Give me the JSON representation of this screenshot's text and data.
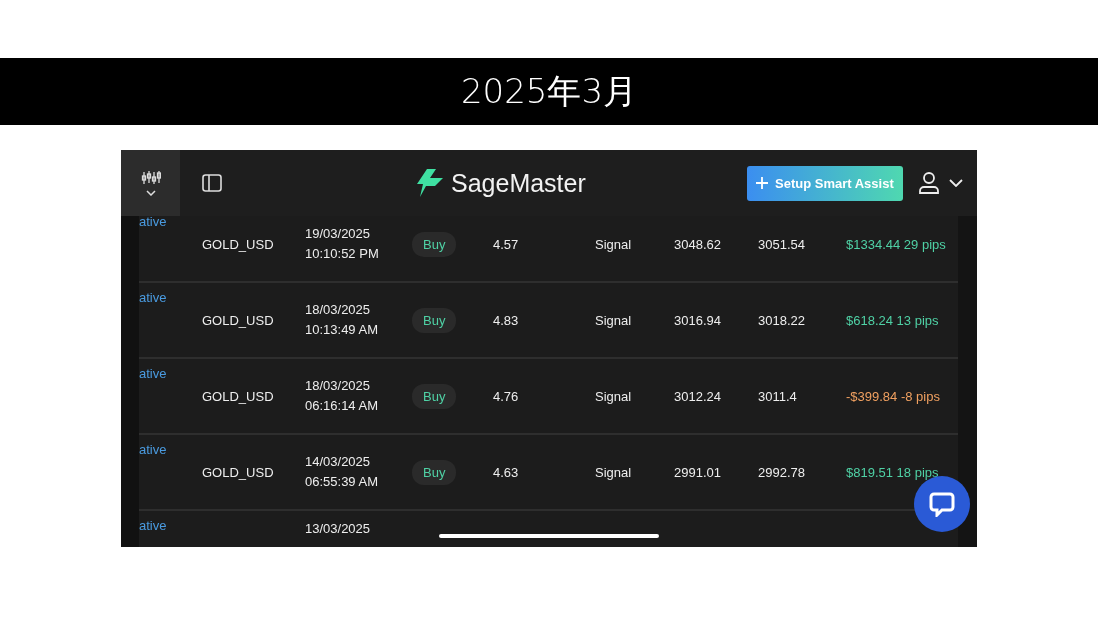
{
  "slide_title": "2025年3月",
  "app": {
    "brand": "SageMaster",
    "setup_button": "Setup Smart Assist"
  },
  "rows": [
    {
      "column_1": "ative",
      "symbol": "GOLD_USD",
      "date": "19/03/2025",
      "time": "10:10:52 PM",
      "side": "Buy",
      "lots": "4.57",
      "source": "Signal",
      "open": "3048.62",
      "close": "3051.54",
      "pnl": "$1334.44 29 pips",
      "kind": "gain"
    },
    {
      "column_1": "ative",
      "symbol": "GOLD_USD",
      "date": "18/03/2025",
      "time": "10:13:49 AM",
      "side": "Buy",
      "lots": "4.83",
      "source": "Signal",
      "open": "3016.94",
      "close": "3018.22",
      "pnl": "$618.24 13 pips",
      "kind": "gain"
    },
    {
      "column_1": "ative",
      "symbol": "GOLD_USD",
      "date": "18/03/2025",
      "time": "06:16:14 AM",
      "side": "Buy",
      "lots": "4.76",
      "source": "Signal",
      "open": "3012.24",
      "close": "3011.4",
      "pnl": "-$399.84 -8 pips",
      "kind": "loss"
    },
    {
      "column_1": "ative",
      "symbol": "GOLD_USD",
      "date": "14/03/2025",
      "time": "06:55:39 AM",
      "side": "Buy",
      "lots": "4.63",
      "source": "Signal",
      "open": "2991.01",
      "close": "2992.78",
      "pnl": "$819.51 18 pips",
      "kind": "gain"
    },
    {
      "column_1": "ative",
      "date": "13/03/2025"
    }
  ]
}
